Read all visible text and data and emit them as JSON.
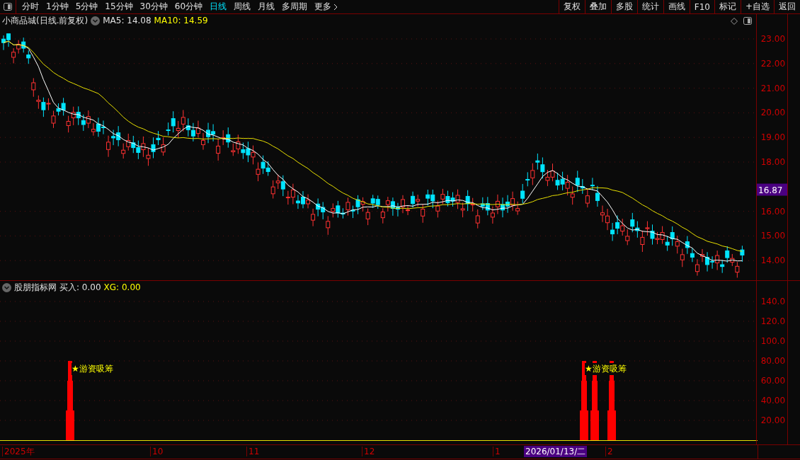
{
  "toolbar": {
    "periods": [
      {
        "label": "分时",
        "selected": false
      },
      {
        "label": "1分钟",
        "selected": false
      },
      {
        "label": "5分钟",
        "selected": false
      },
      {
        "label": "15分钟",
        "selected": false
      },
      {
        "label": "30分钟",
        "selected": false
      },
      {
        "label": "60分钟",
        "selected": false
      },
      {
        "label": "日线",
        "selected": true
      },
      {
        "label": "周线",
        "selected": false
      },
      {
        "label": "月线",
        "selected": false
      },
      {
        "label": "多周期",
        "selected": false
      },
      {
        "label": "更多",
        "selected": false
      }
    ],
    "buttons": [
      "复权",
      "叠加",
      "多股",
      "统计",
      "画线",
      "F10",
      "标记",
      "+自选",
      "返回"
    ]
  },
  "price_chart": {
    "title": "小商品城(日线.前复权)",
    "ma5": "MA5: 14.08",
    "ma10": "MA10: 14.59",
    "axis_ticks": [
      "23.00",
      "22.00",
      "21.00",
      "20.00",
      "19.00",
      "18.00",
      "16.00",
      "15.00",
      "14.00"
    ],
    "price_tag": "16.87"
  },
  "indicator": {
    "title": "股朋指标网",
    "buy": "买入: 0.00",
    "xg": "XG: 0.00",
    "axis_ticks": [
      "140.0",
      "120.0",
      "100.0",
      "80.00",
      "60.00",
      "40.00",
      "20.00"
    ],
    "signals": [
      "★游资吸筹",
      "★游资吸筹"
    ]
  },
  "date_axis": {
    "labels": [
      "2025年",
      "10",
      "11",
      "12",
      "1",
      "2"
    ],
    "cursor": "2026/01/13/二"
  }
}
